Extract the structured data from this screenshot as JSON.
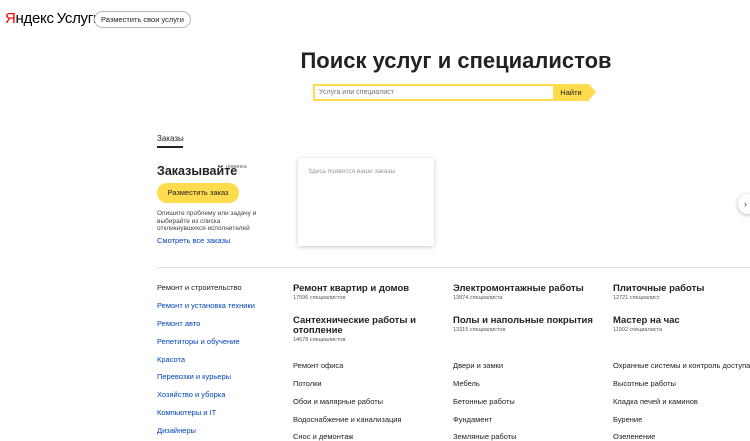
{
  "header": {
    "logo_y": "Я",
    "logo_rest": "ндекс",
    "logo_service": "Услуги",
    "offer_button": "Разместить свои услуги"
  },
  "search": {
    "title": "Поиск услуг и специалистов",
    "placeholder": "Услуга или специалист",
    "button": "Найти"
  },
  "orders": {
    "tab": "Заказы",
    "heading": "Заказывайте",
    "badge": "новинка",
    "place_button": "Разместить заказ",
    "description": "Опишите проблему или задачу и выбирайте из списка откликнувшихся исполнителей",
    "see_all": "Смотреть все заказы",
    "card_text": "Здесь появятся ваши заказы",
    "next_arrow": "›"
  },
  "categories": [
    "Ремонт и строительство",
    "Ремонт и установка техники",
    "Ремонт авто",
    "Репетиторы и обучение",
    "Красота",
    "Перевозки и курьеры",
    "Хозяйство и уборка",
    "Компьютеры и IT",
    "Дизайнеры"
  ],
  "groups": [
    {
      "title": "Ремонт квартир и домов",
      "count": "17596 специалистов"
    },
    {
      "title": "Электромонтажные работы",
      "count": "13874 специалиста"
    },
    {
      "title": "Плиточные работы",
      "count": "12721 специалист"
    },
    {
      "title_line1": "Сантехнические работы и",
      "title_line2": "отопление",
      "count": "14678 специалистов"
    },
    {
      "title": "Полы и напольные покрытия",
      "count": "13315 специалистов"
    },
    {
      "title": "Мастер на час",
      "count": "11902 специалиста"
    }
  ],
  "subcategories": {
    "col1": [
      "Ремонт офиса",
      "Потолки",
      "Обои и малярные работы",
      "Водоснабжение и канализация",
      "Снос и демонтаж"
    ],
    "col2": [
      "Двери и замки",
      "Мебель",
      "Бетонные работы",
      "Фундамент",
      "Земляные работы"
    ],
    "col3": [
      "Охранные системы и контроль доступа",
      "Высотные работы",
      "Кладка печей и каминов",
      "Бурение",
      "Озеленение"
    ]
  }
}
